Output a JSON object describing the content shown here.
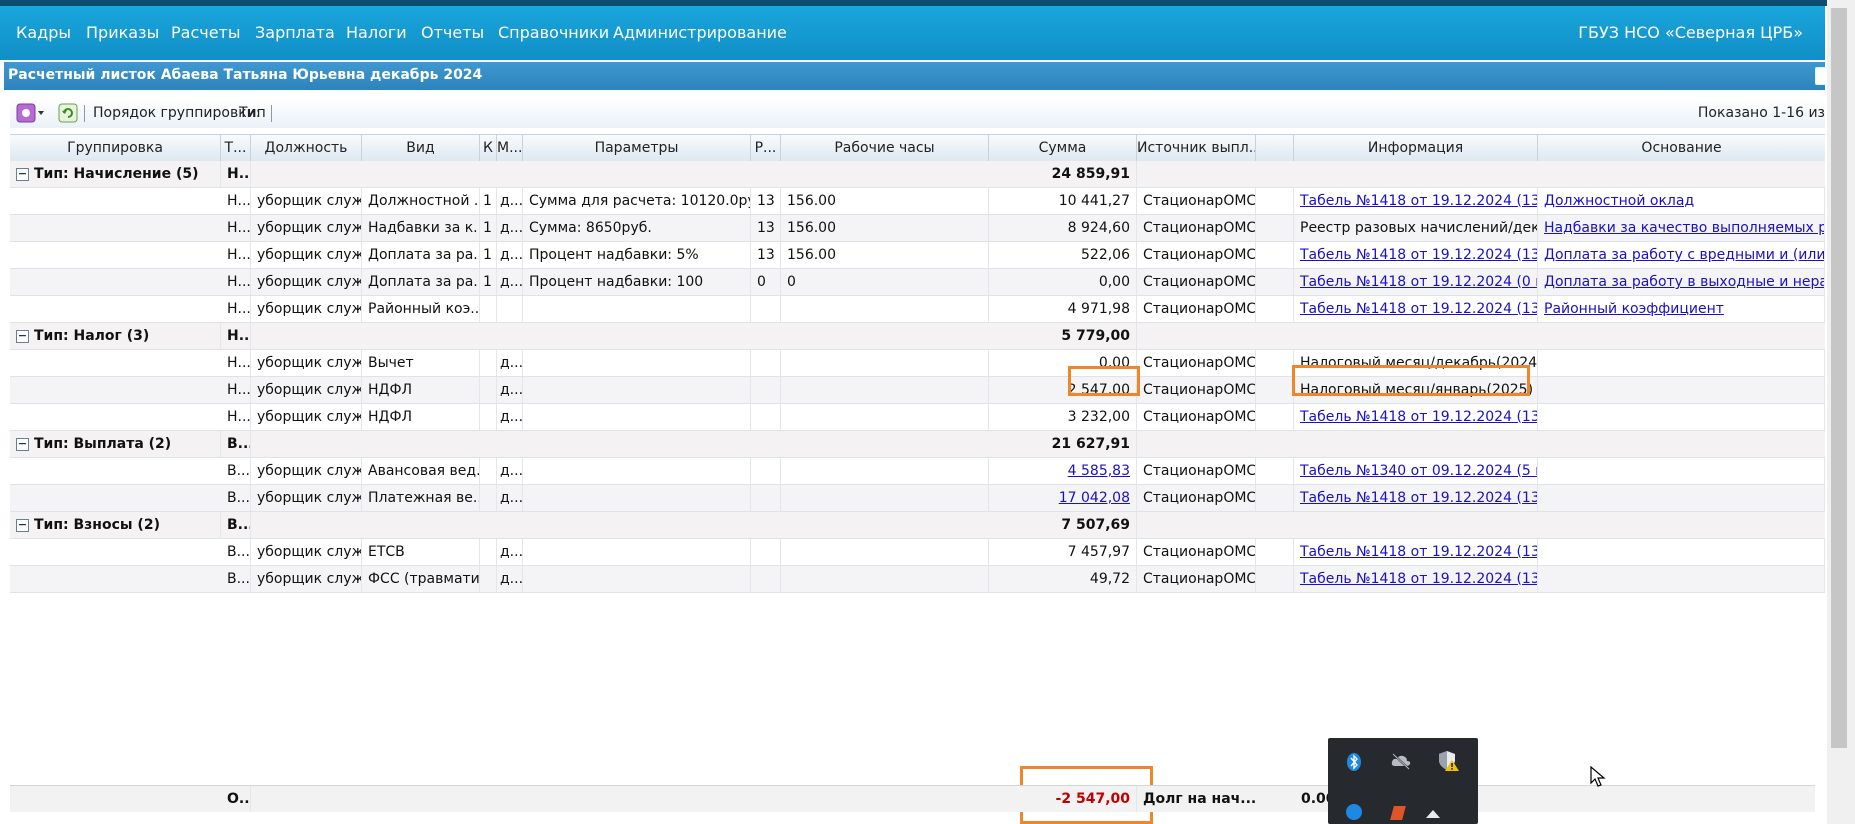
{
  "nav": {
    "items": [
      "Кадры",
      "Приказы",
      "Расчеты",
      "Зарплата",
      "Налоги",
      "Отчеты",
      "Справочники",
      "Администрирование"
    ],
    "org": "ГБУЗ НСО «Северная ЦРБ»"
  },
  "window": {
    "title": "Расчетный листок Абаева Татьяна Юрьевна декабрь 2024"
  },
  "toolbar": {
    "grouping_label": "Порядок группировки:",
    "grouping_value": "Тип",
    "shown": "Показано 1-16 из"
  },
  "columns": [
    "Группировка",
    "Т...",
    "Должность",
    "Вид",
    "К",
    "М...",
    "Параметры",
    "Р...",
    "Рабочие часы",
    "Сумма",
    "Источник выпл...",
    "",
    "Информация",
    "Основание"
  ],
  "groups": {
    "accrual": {
      "label": "Тип: Начисление (5)",
      "t": "Н...",
      "sum": "24 859,91"
    },
    "tax": {
      "label": "Тип: Налог (3)",
      "t": "Н...",
      "sum": "5 779,00"
    },
    "payout": {
      "label": "Тип: Выплата (2)",
      "t": "В...",
      "sum": "21 627,91"
    },
    "contrib": {
      "label": "Тип: Взносы (2)",
      "t": "В...",
      "sum": "7 507,69"
    }
  },
  "rows": {
    "r1": {
      "t": "Н...",
      "pos": "уборщик служ...",
      "kind": "Должностной ...",
      "k": "1",
      "m": "д...",
      "params": "Сумма для расчета: 10120.0ру...",
      "r": "13",
      "hours": "156.00",
      "sum": "10 441,27",
      "src": "СтационарОМС",
      "info": "Табель №1418 от 19.12.2024 (13 ...",
      "basis": "Должностной оклад"
    },
    "r2": {
      "t": "Н...",
      "pos": "уборщик служ...",
      "kind": "Надбавки за к...",
      "k": "1",
      "m": "д...",
      "params": "Сумма: 8650руб.",
      "r": "13",
      "hours": "156.00",
      "sum": "8 924,60",
      "src": "СтационарОМС",
      "info": "Реестр разовых начислений/дека...",
      "basis": "Надбавки за качество выполняемых раб..."
    },
    "r3": {
      "t": "Н...",
      "pos": "уборщик служ...",
      "kind": "Доплата за ра...",
      "k": "1",
      "m": "д...",
      "params": "Процент надбавки: 5%",
      "r": "13",
      "hours": "156.00",
      "sum": "522,06",
      "src": "СтационарОМС",
      "info": "Табель №1418 от 19.12.2024 (13 ...",
      "basis": "Доплата за работу с вредными и (или) о..."
    },
    "r4": {
      "t": "Н...",
      "pos": "уборщик служ...",
      "kind": "Доплата за ра...",
      "k": "1",
      "m": "д...",
      "params": "Процент надбавки: 100",
      "r": "0",
      "hours": "0",
      "sum": "0,00",
      "src": "СтационарОМС",
      "info": "Табель №1418 от 19.12.2024 (0 и...",
      "basis": "Доплата за работу в выходные и нерабо..."
    },
    "r5": {
      "t": "Н...",
      "pos": "уборщик служ...",
      "kind": "Районный коэ...",
      "sum": "4 971,98",
      "src": "СтационарОМС",
      "info": "Табель №1418 от 19.12.2024 (13 ...",
      "basis": "Районный коэффициент"
    },
    "r6": {
      "t": "Н...",
      "pos": "уборщик служ...",
      "kind": "Вычет",
      "m": "д...",
      "sum": "0,00",
      "src": "СтационарОМС",
      "info": "Налоговый месяц/декабрь(2024)"
    },
    "r7": {
      "t": "Н...",
      "pos": "уборщик служ...",
      "kind": "НДФЛ",
      "m": "д...",
      "sum": "2 547,00",
      "src": "СтационарОМС",
      "info": "Налоговый месяц/январь(2025)"
    },
    "r8": {
      "t": "Н...",
      "pos": "уборщик служ...",
      "kind": "НДФЛ",
      "m": "д...",
      "sum": "3 232,00",
      "src": "СтационарОМС",
      "info": "Табель №1418 от 19.12.2024 (13 ..."
    },
    "r9": {
      "t": "В...",
      "pos": "уборщик служ...",
      "kind": "Авансовая вед...",
      "m": "д...",
      "sum": "4 585,83",
      "src": "СтационарОМС",
      "info": "Табель №1340 от 09.12.2024 (5 и..."
    },
    "r10": {
      "t": "В...",
      "pos": "уборщик служ...",
      "kind": "Платежная ве...",
      "m": "д...",
      "sum": "17 042,08",
      "src": "СтационарОМС",
      "info": "Табель №1418 от 19.12.2024 (13 ..."
    },
    "r11": {
      "t": "В...",
      "pos": "уборщик служ...",
      "kind": "ЕТСВ",
      "m": "д...",
      "sum": "7 457,97",
      "src": "СтационарОМС",
      "info": "Табель №1418 от 19.12.2024 (13 ..."
    },
    "r12": {
      "t": "В...",
      "pos": "уборщик служ...",
      "kind": "ФСС (травмати...",
      "m": "д...",
      "sum": "49,72",
      "src": "СтационарОМС",
      "info": "Табель №1418 от 19.12.2024 (13 ..."
    }
  },
  "footer": {
    "t": "О...",
    "sum": "-2 547,00",
    "src": "Долг на нач...",
    "extra": "0.00"
  },
  "colors": {
    "nav": "#1aa6dc",
    "title_bar": "#2d84bc",
    "link": "#1a10c8",
    "highlight": "#f0862a",
    "negative": "#c00000"
  },
  "icons": {
    "tray": [
      "bluetooth-icon",
      "cloud-off-icon",
      "shield-warning-icon"
    ]
  }
}
